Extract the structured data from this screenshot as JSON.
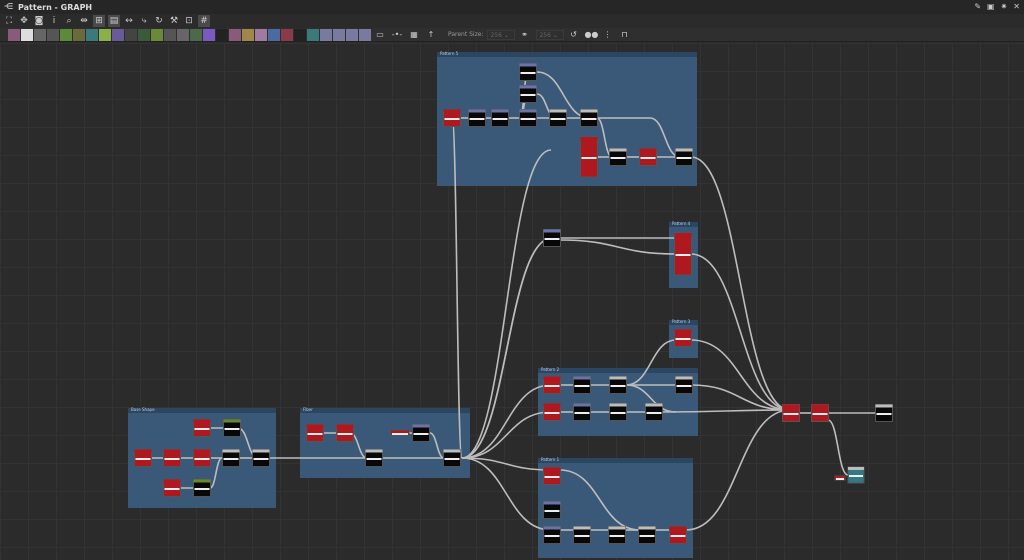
{
  "window": {
    "title": "Pattern - GRAPH",
    "controls": [
      "pin-icon",
      "float-icon",
      "maximize-icon",
      "close-icon"
    ]
  },
  "toolbar_top": [
    {
      "icon": "frame-all-icon"
    },
    {
      "icon": "pan-icon"
    },
    {
      "icon": "screenshot-icon"
    },
    {
      "icon": "info-icon"
    },
    {
      "icon": "search-icon"
    },
    {
      "icon": "node-link-icon"
    },
    {
      "icon": "graph-layout-icon",
      "active": true
    },
    {
      "icon": "comment-icon",
      "active": true
    },
    {
      "icon": "align-horizontal-icon"
    },
    {
      "icon": "connector-icon"
    },
    {
      "icon": "refresh-icon"
    },
    {
      "icon": "tools-icon"
    },
    {
      "icon": "export-icon"
    },
    {
      "icon": "grid-snap-icon",
      "active": true
    }
  ],
  "toolbar_nodes": [
    {
      "icon": "bitmap-icon",
      "color": "#8a5a7a"
    },
    {
      "icon": "uniform-color-icon",
      "color": "#ddd"
    },
    {
      "icon": "blur-icon",
      "color": "#666"
    },
    {
      "icon": "shuffle-icon",
      "color": "#555"
    },
    {
      "icon": "gradient-icon",
      "color": "#5c8a3a"
    },
    {
      "icon": "levels-icon",
      "color": "#6a6a3a"
    },
    {
      "icon": "transform-icon",
      "color": "#3a7a7a"
    },
    {
      "icon": "curve-icon",
      "color": "#8ab04a"
    },
    {
      "icon": "shape-icon",
      "color": "#6a5a9a"
    },
    {
      "icon": "tile-icon",
      "color": "#444"
    },
    {
      "icon": "blend-icon",
      "color": "#3a5a3a"
    },
    {
      "icon": "tile-sampler-icon",
      "color": "#6a8a3a"
    },
    {
      "icon": "value-icon",
      "color": "#555"
    },
    {
      "icon": "histogram-icon",
      "color": "#666"
    },
    {
      "icon": "warp-icon",
      "color": "#4a6a4a"
    },
    {
      "icon": "color-wheel-icon",
      "color": "#7a5ac0"
    },
    {
      "icon": "noise-icon",
      "color": "#222"
    },
    {
      "icon": "text-icon",
      "color": "#8a5a7a"
    },
    {
      "icon": "triangle-icon",
      "color": "#a0884a"
    },
    {
      "icon": "font-icon",
      "color": "#a07aa0"
    },
    {
      "icon": "bounding-box-icon",
      "color": "#4a6aa0"
    },
    {
      "icon": "svg-icon",
      "color": "#8a3a4a"
    },
    {
      "icon": "fx-map-icon",
      "color": "#222"
    },
    {
      "icon": "output-icon",
      "color": "#3a7a7a"
    },
    {
      "icon": "input-icon",
      "color": "#7a7aa0"
    },
    {
      "icon": "switch-icon",
      "color": "#7a7aa0"
    },
    {
      "icon": "pixel-processor-icon",
      "color": "#7a7aa0"
    },
    {
      "icon": "dot-icon",
      "color": "#7a7aa0"
    }
  ],
  "toolbar_tools": [
    "comment-icon",
    "pin-icon",
    "frame-icon",
    "navigation-pin-icon"
  ],
  "parent_size": {
    "label": "Parent Size:",
    "width": "256",
    "height": "256"
  },
  "toolbar_tail": [
    "reset-icon",
    "align-h-icon",
    "align-v-icon",
    "snap-icon"
  ],
  "frames": {
    "pattern5": "Pattern 5",
    "pattern4": "Pattern 4",
    "pattern3": "Pattern 3",
    "pattern2": "Pattern 2",
    "pattern1": "Pattern 1",
    "base_shape": "Base Shape",
    "fiber": "Fiber"
  },
  "colors": {
    "frame": "#3a5878",
    "wire": "#bdbdbd",
    "node_red": "#b01820",
    "node_blue": "#6b74a8",
    "node_green": "#6a8a2a",
    "node_grey": "#bdbdbd"
  }
}
